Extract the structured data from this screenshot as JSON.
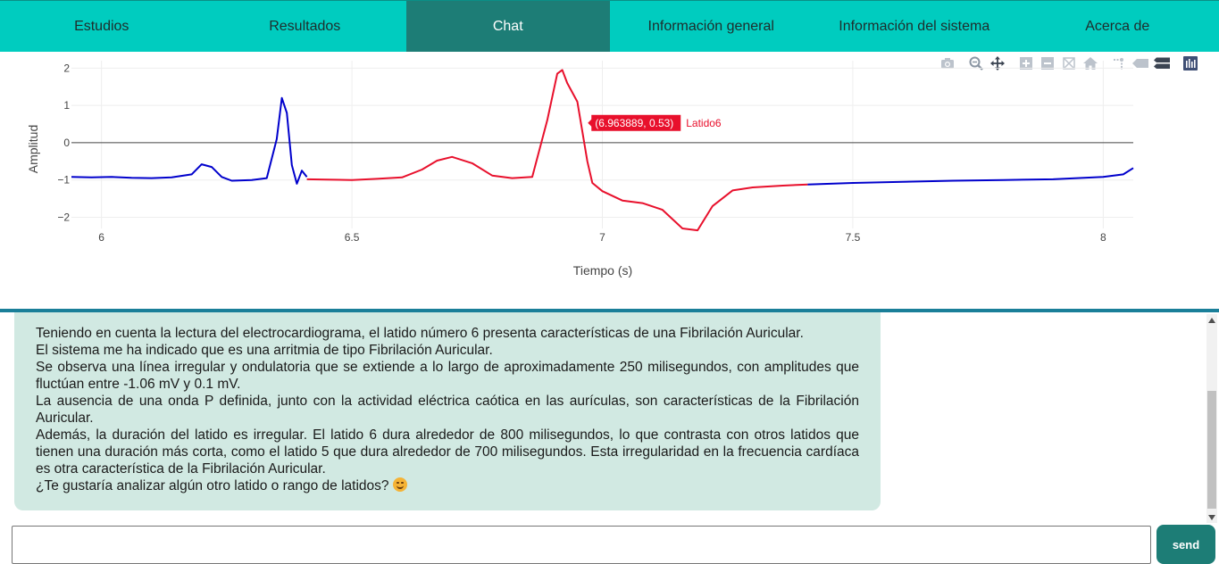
{
  "nav": {
    "items": [
      {
        "label": "Estudios",
        "active": false
      },
      {
        "label": "Resultados",
        "active": false
      },
      {
        "label": "Chat",
        "active": true
      },
      {
        "label": "Información general",
        "active": false
      },
      {
        "label": "Información del sistema",
        "active": false
      },
      {
        "label": "Acerca de",
        "active": false
      }
    ]
  },
  "modebar": {
    "icons": [
      "camera-icon",
      "zoom-icon",
      "pan-icon",
      "zoom-in-icon",
      "zoom-out-icon",
      "autoscale-icon",
      "home-icon",
      "spike-lines-icon",
      "hover-closest-icon",
      "hover-compare-icon",
      "plotly-logo-icon"
    ]
  },
  "chart_data": {
    "type": "line",
    "xlabel": "Tiempo (s)",
    "ylabel": "Amplitud",
    "xlim": [
      5.94,
      8.06
    ],
    "ylim": [
      -2.3,
      2.2
    ],
    "x_ticks": [
      6,
      6.5,
      7,
      7.5,
      8
    ],
    "x_tick_labels": [
      "6",
      "6.5",
      "7",
      "7.5",
      "8"
    ],
    "y_ticks": [
      2,
      1,
      0,
      -1,
      -2
    ],
    "y_tick_labels": [
      "2",
      "1",
      "0",
      "−1",
      "−2"
    ],
    "grid": true,
    "zero_line": true,
    "colors": {
      "signal": "#0000cc",
      "highlight": "#e8102c"
    },
    "series": [
      {
        "name": "",
        "color": "#0000cc",
        "x": [
          5.94,
          5.98,
          6.02,
          6.06,
          6.1,
          6.14,
          6.18,
          6.2,
          6.22,
          6.24,
          6.26,
          6.3,
          6.33,
          6.35,
          6.36,
          6.37,
          6.38,
          6.39,
          6.4,
          6.41
        ],
        "y": [
          -0.92,
          -0.93,
          -0.92,
          -0.94,
          -0.95,
          -0.93,
          -0.85,
          -0.58,
          -0.65,
          -0.92,
          -1.02,
          -1.0,
          -0.95,
          0.1,
          1.2,
          0.8,
          -0.6,
          -1.1,
          -0.75,
          -0.92
        ]
      },
      {
        "name": "Latido6",
        "color": "#e8102c",
        "x": [
          6.41,
          6.45,
          6.5,
          6.55,
          6.6,
          6.64,
          6.67,
          6.7,
          6.74,
          6.78,
          6.82,
          6.86,
          6.89,
          6.91,
          6.92,
          6.93,
          6.95,
          6.97,
          6.98,
          7.0,
          7.04,
          7.08,
          7.12,
          7.16,
          7.19,
          7.22,
          7.26,
          7.3,
          7.36,
          7.41
        ],
        "y": [
          -0.98,
          -0.99,
          -1.0,
          -0.97,
          -0.93,
          -0.72,
          -0.48,
          -0.38,
          -0.55,
          -0.88,
          -0.95,
          -0.92,
          0.6,
          1.85,
          1.95,
          1.6,
          1.1,
          -0.5,
          -1.08,
          -1.3,
          -1.55,
          -1.62,
          -1.8,
          -2.3,
          -2.35,
          -1.7,
          -1.28,
          -1.2,
          -1.15,
          -1.12
        ]
      },
      {
        "name": "",
        "color": "#0000cc",
        "x": [
          7.41,
          7.5,
          7.6,
          7.7,
          7.8,
          7.9,
          8.0,
          8.04,
          8.06
        ],
        "y": [
          -1.12,
          -1.08,
          -1.05,
          -1.02,
          -1.0,
          -0.98,
          -0.92,
          -0.85,
          -0.68
        ]
      }
    ],
    "annotation": {
      "text": "(6.963889, 0.53)",
      "series_label": "Latido6",
      "x": 6.963889,
      "y": 0.53
    }
  },
  "chat": {
    "paragraphs": [
      "Teniendo en cuenta la lectura del electrocardiograma, el latido número 6 presenta características de una Fibrilación Auricular.",
      "El sistema me ha indicado que es una arritmia de tipo Fibrilación Auricular.",
      "Se observa una línea irregular y ondulatoria que se extiende a lo largo de aproximadamente 250 milisegundos, con amplitudes que fluctúan entre -1.06 mV y 0.1 mV.",
      "La ausencia de una onda P definida, junto con la actividad eléctrica caótica en las aurículas, son características de la Fibrilación Auricular.",
      "Además, la duración del latido es irregular. El latido 6 dura alrededor de 800 milisegundos, lo que contrasta con otros latidos que tienen una duración más corta, como el latido 5 que dura alrededor de 700 milisegundos. Esta irregularidad en la frecuencia cardíaca es otra característica de la Fibrilación Auricular.",
      "¿Te gustaría analizar algún otro latido o rango de latidos?"
    ]
  },
  "input": {
    "value": "",
    "placeholder": ""
  },
  "send": {
    "label": "send"
  }
}
